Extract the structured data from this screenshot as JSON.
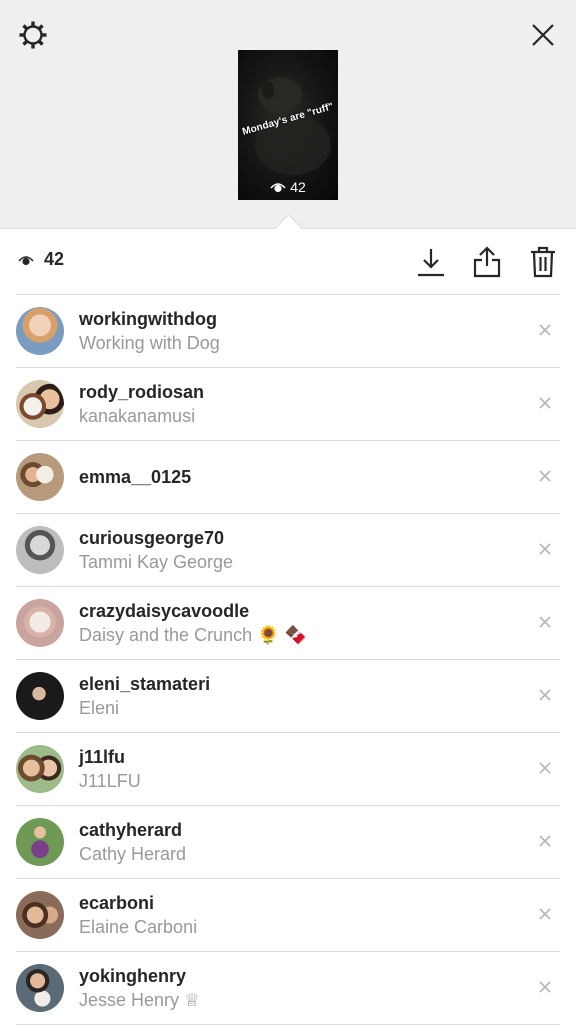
{
  "story": {
    "caption": "Monday's are \"ruff\"",
    "views": "42"
  },
  "toolbar": {
    "views": "42"
  },
  "viewers": [
    {
      "username": "workingwithdog",
      "fullname": "Working with Dog",
      "avatar_color": "#c9a27a"
    },
    {
      "username": "rody_rodiosan",
      "fullname": "kanakanamusi",
      "avatar_color": "#b88a66"
    },
    {
      "username": "emma__0125",
      "fullname": "",
      "avatar_color": "#a58a6c"
    },
    {
      "username": "curiousgeorge70",
      "fullname": "Tammi Kay George",
      "avatar_color": "#9a9a9a"
    },
    {
      "username": "crazydaisycavoodle",
      "fullname": "Daisy and the Crunch 🌻 🍫",
      "avatar_color": "#d4b9b0"
    },
    {
      "username": "eleni_stamateri",
      "fullname": "Eleni",
      "avatar_color": "#2b2b2b"
    },
    {
      "username": "j11lfu",
      "fullname": "J11LFU",
      "avatar_color": "#8a6a50"
    },
    {
      "username": "cathyherard",
      "fullname": "Cathy Herard",
      "avatar_color": "#5f8a4e"
    },
    {
      "username": "ecarboni",
      "fullname": "Elaine Carboni",
      "avatar_color": "#7a5a48"
    },
    {
      "username": "yokinghenry",
      "fullname": "Jesse Henry ♕",
      "avatar_color": "#6f7f8a"
    }
  ]
}
